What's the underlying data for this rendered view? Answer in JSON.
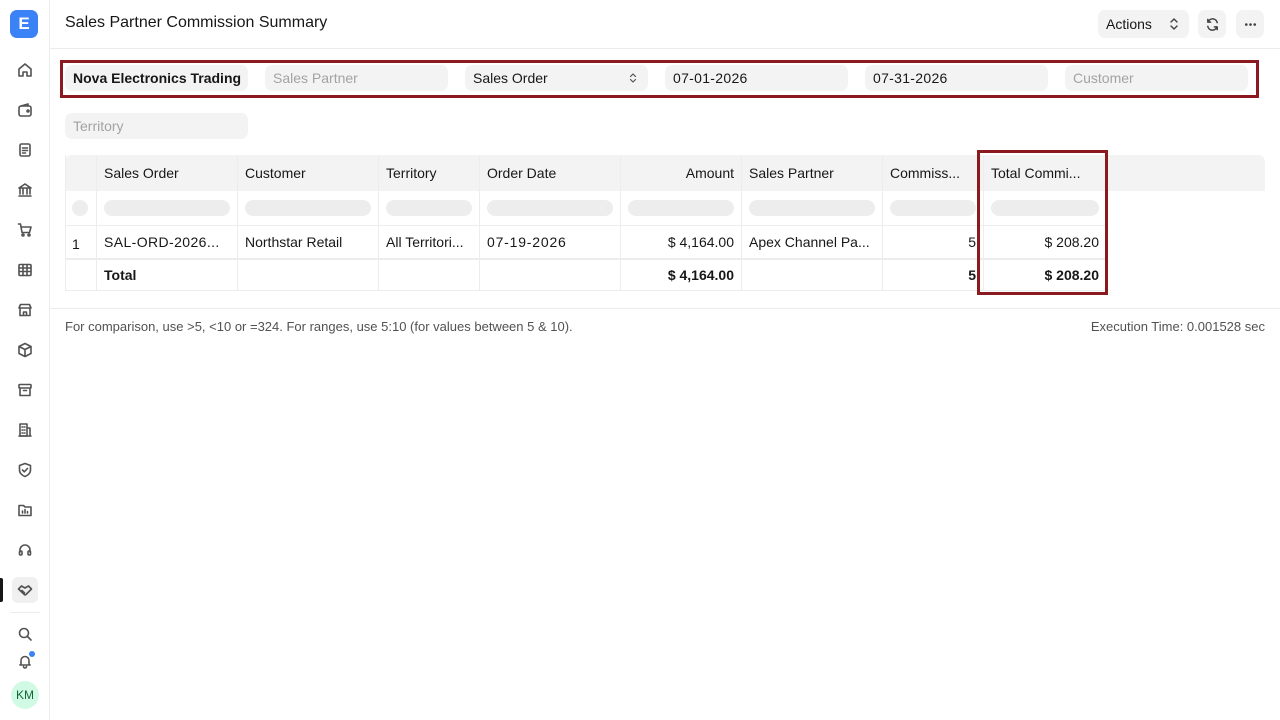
{
  "app": {
    "logo_letter": "E",
    "avatar_initials": "KM"
  },
  "sidebar": {
    "icons": [
      "home-icon",
      "wallet-icon",
      "document-icon",
      "bank-icon",
      "cart-icon",
      "table-icon",
      "store-icon",
      "package-icon",
      "archive-icon",
      "building-icon",
      "shield-icon",
      "folder-chart-icon",
      "headset-icon",
      "handshake-icon"
    ],
    "bottom_icons": [
      "search-icon",
      "bell-icon"
    ]
  },
  "header": {
    "title": "Sales Partner Commission Summary",
    "actions_label": "Actions"
  },
  "filters": {
    "company": "Nova Electronics Trading",
    "sales_partner_placeholder": "Sales Partner",
    "doctype": "Sales Order",
    "from_date": "07-01-2026",
    "to_date": "07-31-2026",
    "customer_placeholder": "Customer",
    "territory_placeholder": "Territory"
  },
  "table": {
    "columns": [
      "Sales Order",
      "Customer",
      "Territory",
      "Order Date",
      "Amount",
      "Sales Partner",
      "Commiss...",
      "Total Commi..."
    ],
    "rows": [
      {
        "index": "1",
        "sales_order": "SAL-ORD-2026...",
        "customer": "Northstar Retail",
        "territory": "All Territori...",
        "order_date": "07-19-2026",
        "amount": "$ 4,164.00",
        "sales_partner": "Apex Channel Pa...",
        "commission_rate": "5",
        "total_commission": "$ 208.20"
      }
    ],
    "total": {
      "label": "Total",
      "amount": "$ 4,164.00",
      "commission_rate": "5",
      "total_commission": "$ 208.20"
    }
  },
  "footer": {
    "note": "For comparison, use >5, <10 or =324. For ranges, use 5:10 (for values between 5 & 10).",
    "execution_time": "Execution Time: 0.001528 sec"
  },
  "colors": {
    "accent": "#3b82f6",
    "highlight_border": "#8b1a1f"
  }
}
